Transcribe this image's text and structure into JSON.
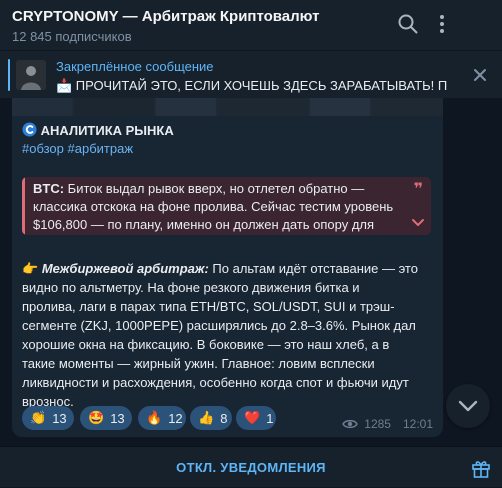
{
  "header": {
    "title": "CRYPTONOMY — Арбитраж Криптовалют",
    "subscribers": "12 845 подписчиков",
    "icons": [
      "search-icon",
      "more-icon"
    ]
  },
  "pinned": {
    "label": "Закреплённое сообщение",
    "text": "📩 ПРОЧИТАЙ ЭТО, ЕСЛИ ХОЧЕШЬ ЗДЕСЬ ЗАРАБАТЫВАТЬ!  П...",
    "icon": "close-icon"
  },
  "post": {
    "heading": "АНАЛИТИКА РЫНКА",
    "heading_icon": "c-logo-icon",
    "hashtags": "#обзор #арбитраж",
    "quote": {
      "label": "BTC:",
      "line1_rest": " Биток выдал рывок вверх, но отлетел обратно —",
      "line2": "классика отскока на фоне пролива. Сейчас тестим уровень",
      "line3": "$106,800 — по плану, именно он должен дать опору для"
    },
    "body": {
      "emoji": "👉",
      "lead": "Межбиржевой арбитраж:",
      "line1_rest": " По альтам идёт отставание — это",
      "line2": "видно по альтметру. На фоне резкого движения битка и",
      "line3": "пролива, лаги в парах типа ETH/BTC, SOL/USDT, SUI и трэш-",
      "line4": "сегменте (ZKJ, 1000PEPE) расширялись до 2.8–3.6%. Рынок дал",
      "line5": "хорошие окна на фиксацию. В боковике — это наш хлеб, а в",
      "line6": "такие моменты — жирный ужин. Главное: ловим всплески",
      "line7": "ликвидности и расхождения, особенно когда спот и фьючи идут",
      "line8": "врознос."
    },
    "reactions": [
      {
        "emoji": "👏",
        "count": "13"
      },
      {
        "emoji": "🤩",
        "count": "13"
      },
      {
        "emoji": "🔥",
        "count": "12"
      },
      {
        "emoji": "👍",
        "count": "8"
      },
      {
        "emoji": "❤️",
        "count": "1"
      }
    ],
    "views": "1285",
    "time": "12:01"
  },
  "bottom": {
    "mute_label": "ОТКЛ. УВЕДОМЛЕНИЯ",
    "gift_icon": "gift-icon"
  },
  "colors": {
    "background": "#0e1621",
    "panel": "#17212b",
    "bubble": "#182533",
    "accent": "#5eb5f7",
    "link": "#6ab3f3",
    "quote_bg": "#3a2531",
    "quote_bar": "#e06c75",
    "reaction_bg": "#2b5278"
  }
}
